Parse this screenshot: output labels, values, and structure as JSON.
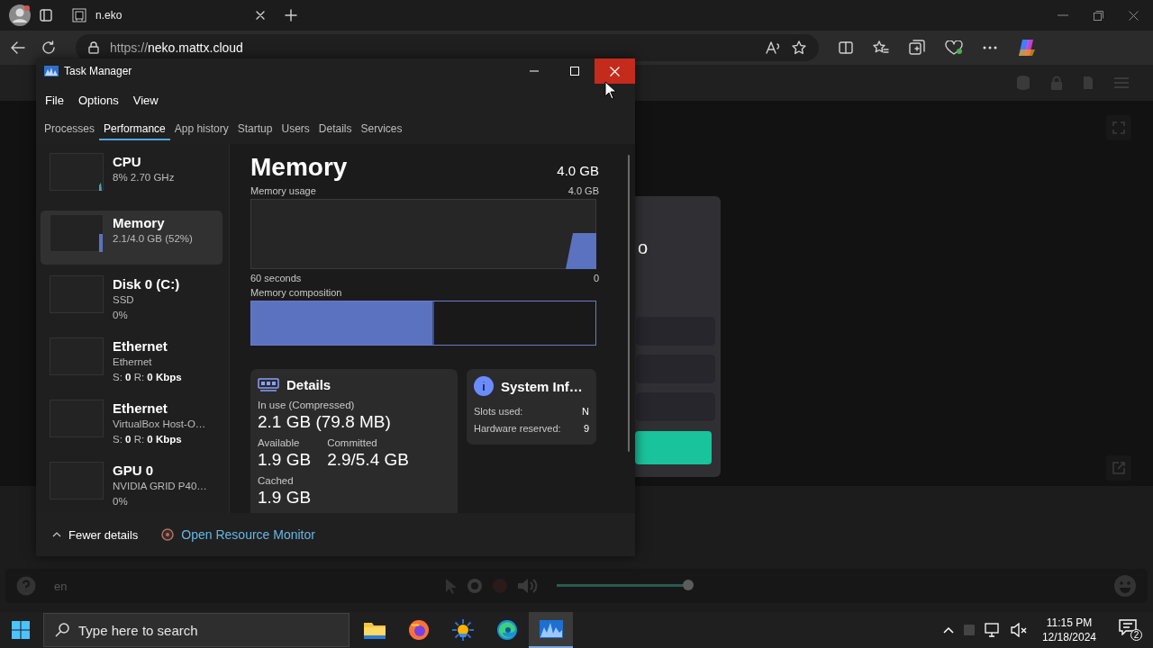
{
  "browser": {
    "tab": {
      "title": "n.eko"
    },
    "url": {
      "scheme": "https://",
      "host": "neko.mattx.cloud"
    }
  },
  "neko": {
    "login_card": {
      "title": "o"
    },
    "controls": {
      "language": "en",
      "volume": {
        "level": 1
      }
    }
  },
  "task_manager": {
    "title": "Task Manager",
    "menu": [
      "File",
      "Options",
      "View"
    ],
    "tabs": [
      {
        "label": "Processes",
        "selected": false
      },
      {
        "label": "Performance",
        "selected": true
      },
      {
        "label": "App history",
        "selected": false
      },
      {
        "label": "Startup",
        "selected": false
      },
      {
        "label": "Users",
        "selected": false
      },
      {
        "label": "Details",
        "selected": false
      },
      {
        "label": "Services",
        "selected": false
      }
    ],
    "resources": [
      {
        "kind": "cpu",
        "name": "CPU",
        "lines": [
          "8% 2.70 GHz"
        ],
        "selected": false
      },
      {
        "kind": "memory",
        "name": "Memory",
        "lines": [
          "2.1/4.0 GB (52%)"
        ],
        "selected": true
      },
      {
        "kind": "disk",
        "name": "Disk 0 (C:)",
        "lines": [
          "SSD",
          "0%"
        ],
        "selected": false
      },
      {
        "kind": "network",
        "name": "Ethernet",
        "lines": [
          "Ethernet",
          "S: **0** R: **0 Kbps**"
        ],
        "selected": false
      },
      {
        "kind": "network",
        "name": "Ethernet",
        "lines": [
          "VirtualBox Host-O…",
          "S: **0** R: **0 Kbps**"
        ],
        "selected": false
      },
      {
        "kind": "gpu",
        "name": "GPU 0",
        "lines": [
          "NVIDIA GRID P40…",
          "0%"
        ],
        "selected": false
      }
    ],
    "memory": {
      "title": "Memory",
      "total": "4.0 GB",
      "usage": {
        "label": "Memory usage",
        "max": "4.0 GB",
        "left_axis": "60 seconds",
        "right_axis": "0"
      },
      "composition": {
        "label": "Memory composition",
        "level": 0.525
      },
      "details": {
        "title": "Details",
        "stats": [
          {
            "label": "In use (Compressed)",
            "value": "2.1 GB (79.8 MB)"
          },
          {
            "label": "Available",
            "value": "1.9 GB"
          },
          {
            "label": "Committed",
            "value": "2.9/5.4 GB"
          },
          {
            "label": "Cached",
            "value": "1.9 GB"
          }
        ]
      },
      "system_info": {
        "title": "System Inf…",
        "rows": [
          {
            "label": "Slots used:",
            "value": "N"
          },
          {
            "label": "Hardware reserved:",
            "value": "9"
          }
        ]
      }
    },
    "footer": {
      "fewer_details": "Fewer details",
      "resource_monitor": "Open Resource Monitor"
    }
  },
  "taskbar": {
    "search_placeholder": "Type here to search",
    "apps": [
      {
        "kind": "explorer",
        "selected": false
      },
      {
        "kind": "firefox",
        "selected": false
      },
      {
        "kind": "sun",
        "selected": false
      },
      {
        "kind": "edge",
        "selected": false
      },
      {
        "kind": "taskmanager",
        "selected": true
      }
    ],
    "clock": {
      "time": "11:15 PM",
      "date": "12/18/2024"
    },
    "notifications": "2"
  }
}
